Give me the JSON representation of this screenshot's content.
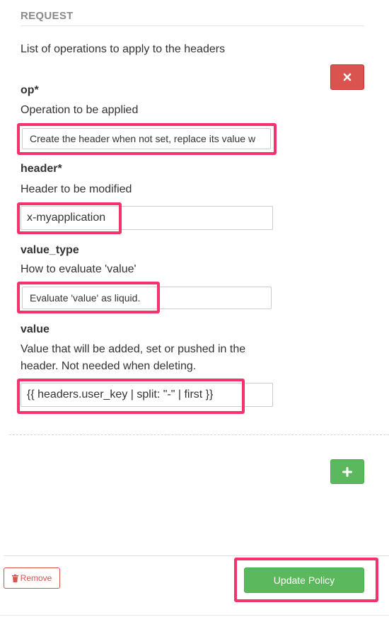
{
  "section": {
    "title": "REQUEST",
    "description": "List of operations to apply to the headers"
  },
  "op": {
    "label": "op*",
    "description": "Operation to be applied",
    "value": "Create the header when not set, replace its value w"
  },
  "header": {
    "label": "header*",
    "description": "Header to be modified",
    "value": "x-myapplication"
  },
  "value_type": {
    "label": "value_type",
    "description": "How to evaluate 'value'",
    "value": "Evaluate 'value' as liquid."
  },
  "value": {
    "label": "value",
    "description_line1": "Value that will be added, set or pushed in the",
    "description_line2": "header. Not needed when deleting.",
    "value": "{{ headers.user_key | split: \"-\" | first  }}"
  },
  "buttons": {
    "remove_label": "Remove",
    "update_label": "Update Policy",
    "remove_item_icon": "times-icon",
    "add_item_icon": "plus-icon",
    "trash_icon": "trash-icon"
  },
  "colors": {
    "danger": "#d9534f",
    "success": "#5cb85c",
    "highlight": "#f5326b"
  }
}
